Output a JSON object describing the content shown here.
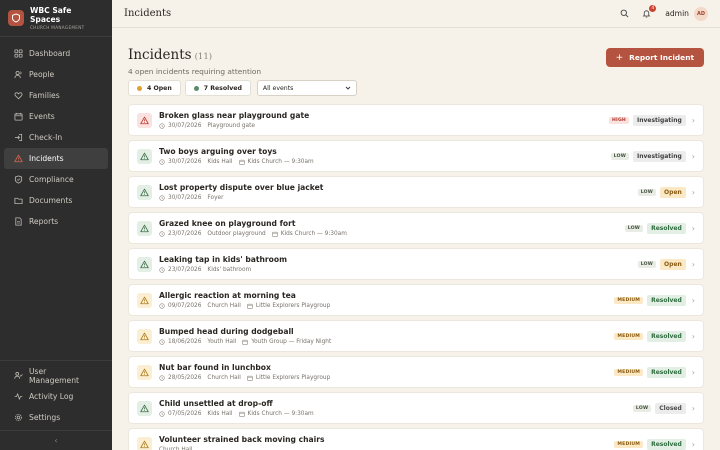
{
  "brand": {
    "name": "WBC Safe Spaces",
    "subtitle": "CHURCH MANAGEMENT"
  },
  "nav": {
    "items": [
      {
        "label": "Dashboard",
        "icon": "grid-icon"
      },
      {
        "label": "People",
        "icon": "person-icon"
      },
      {
        "label": "Families",
        "icon": "heart-icon"
      },
      {
        "label": "Events",
        "icon": "calendar-icon"
      },
      {
        "label": "Check-In",
        "icon": "login-icon"
      },
      {
        "label": "Incidents",
        "icon": "warning-icon",
        "active": true
      },
      {
        "label": "Compliance",
        "icon": "shield-icon"
      },
      {
        "label": "Documents",
        "icon": "folder-icon"
      },
      {
        "label": "Reports",
        "icon": "document-icon"
      }
    ],
    "bottom": [
      {
        "label": "User Management",
        "icon": "users-icon"
      },
      {
        "label": "Activity Log",
        "icon": "activity-icon"
      },
      {
        "label": "Settings",
        "icon": "gear-icon"
      }
    ],
    "collapse": "‹"
  },
  "header": {
    "title": "Incidents",
    "notification_count": "4",
    "user_label": "admin",
    "avatar_initials": "AD"
  },
  "page": {
    "title": "Incidents",
    "count": "(11)",
    "subtitle": "4 open incidents requiring attention",
    "report_button": "Report Incident"
  },
  "filters": {
    "open": "4 Open",
    "resolved": "7 Resolved",
    "select_value": "All events"
  },
  "colors": {
    "accent": "#b4533f",
    "open_dot": "#e0a030",
    "resolved_dot": "#5b8a6a"
  },
  "incidents": [
    {
      "title": "Broken glass near playground gate",
      "date": "30/07/2026",
      "location": "Playground gate",
      "event": "",
      "severity": "HIGH",
      "sevClass": "high",
      "status": "Investigating",
      "statusClass": "investigating"
    },
    {
      "title": "Two boys arguing over toys",
      "date": "30/07/2026",
      "location": "Kids Hall",
      "event": "Kids Church — 9:30am",
      "severity": "LOW",
      "sevClass": "low",
      "status": "Investigating",
      "statusClass": "investigating"
    },
    {
      "title": "Lost property dispute over blue jacket",
      "date": "30/07/2026",
      "location": "Foyer",
      "event": "",
      "severity": "LOW",
      "sevClass": "low",
      "status": "Open",
      "statusClass": "open"
    },
    {
      "title": "Grazed knee on playground fort",
      "date": "23/07/2026",
      "location": "Outdoor playground",
      "event": "Kids Church — 9:30am",
      "severity": "LOW",
      "sevClass": "low",
      "status": "Resolved",
      "statusClass": "resolved"
    },
    {
      "title": "Leaking tap in kids' bathroom",
      "date": "23/07/2026",
      "location": "Kids' bathroom",
      "event": "",
      "severity": "LOW",
      "sevClass": "low",
      "status": "Open",
      "statusClass": "open"
    },
    {
      "title": "Allergic reaction at morning tea",
      "date": "09/07/2026",
      "location": "Church Hall",
      "event": "Little Explorers Playgroup",
      "severity": "MEDIUM",
      "sevClass": "medium",
      "status": "Resolved",
      "statusClass": "resolved"
    },
    {
      "title": "Bumped head during dodgeball",
      "date": "18/06/2026",
      "location": "Youth Hall",
      "event": "Youth Group — Friday Night",
      "severity": "MEDIUM",
      "sevClass": "medium",
      "status": "Resolved",
      "statusClass": "resolved"
    },
    {
      "title": "Nut bar found in lunchbox",
      "date": "28/05/2026",
      "location": "Church Hall",
      "event": "Little Explorers Playgroup",
      "severity": "MEDIUM",
      "sevClass": "medium",
      "status": "Resolved",
      "statusClass": "resolved"
    },
    {
      "title": "Child unsettled at drop-off",
      "date": "07/05/2026",
      "location": "Kids Hall",
      "event": "Kids Church — 9:30am",
      "severity": "LOW",
      "sevClass": "low",
      "status": "Closed",
      "statusClass": "closed"
    },
    {
      "title": "Volunteer strained back moving chairs",
      "date": "",
      "location": "Church Hall",
      "event": "",
      "severity": "MEDIUM",
      "sevClass": "medium",
      "status": "Resolved",
      "statusClass": "resolved"
    }
  ]
}
